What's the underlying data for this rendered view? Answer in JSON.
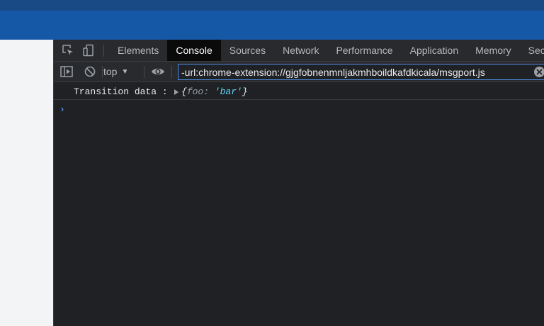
{
  "devtools": {
    "tabs": [
      {
        "label": "Elements"
      },
      {
        "label": "Console"
      },
      {
        "label": "Sources"
      },
      {
        "label": "Network"
      },
      {
        "label": "Performance"
      },
      {
        "label": "Application"
      },
      {
        "label": "Memory"
      },
      {
        "label": "Secur"
      }
    ],
    "active_tab": "Console",
    "toolbar": {
      "context": "top",
      "filter_value": "-url:chrome-extension://gjgfobnenmnljakmhboildkafdkicala/msgport.js"
    },
    "console": {
      "messages": [
        {
          "label": "Transition data : ",
          "object_open": "{",
          "object_key": "foo: ",
          "object_value": "'bar'",
          "object_close": "}"
        }
      ],
      "prompt": "›"
    }
  },
  "colors": {
    "header_dark": "#1a4a86",
    "header_blue": "#1558a6",
    "devtools_bg": "#202124",
    "accent": "#4d8ee8",
    "string_value": "#5cd5fb"
  }
}
